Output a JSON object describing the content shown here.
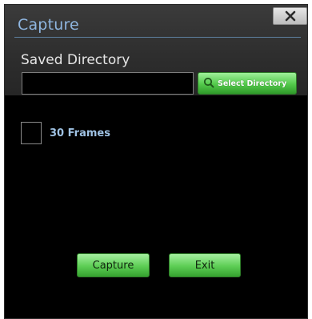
{
  "window": {
    "title": "Capture",
    "close_glyph": "✕"
  },
  "directory": {
    "label": "Saved Directory",
    "value": "",
    "select_button_label": "Select Directory",
    "select_button_icon": "search-icon"
  },
  "options": {
    "frames_label": "30 Frames",
    "frames_checked": false
  },
  "actions": {
    "capture_label": "Capture",
    "exit_label": "Exit"
  },
  "colors": {
    "accent_blue": "#8fb6e0",
    "button_green": "#5ccd54",
    "background": "#000000"
  }
}
